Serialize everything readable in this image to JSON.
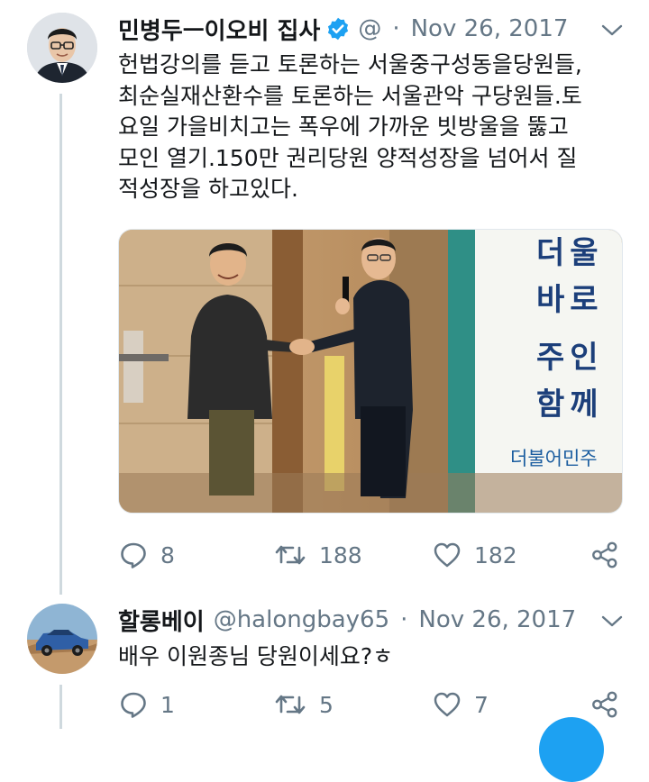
{
  "tweet": {
    "author_name": "민병두ㅡ이오비 집사",
    "handle": "@",
    "separator": "·",
    "date": "Nov 26, 2017",
    "text_lines": [
      "헌법강의를 듣고 토론하는 서울중구성동을당원들,",
      "최순실재산환수를 토론하는 서울관악 구당원들.토",
      "요일 가을비치고는 폭우에 가까운 빗방울을 뚫고",
      "모인 열기.150만 권리당원 양적성장을 넘어서 질",
      "적성장을 하고있다."
    ],
    "photo": {
      "banner_text": [
        "더",
        "울",
        "바",
        "로",
        "주",
        "인",
        "함",
        "께"
      ],
      "banner_footer": "더불어민주"
    },
    "stats": {
      "replies": "8",
      "retweets": "188",
      "likes": "182"
    }
  },
  "reply": {
    "author_name": "할롱베이",
    "handle": "@halongbay65",
    "separator": "·",
    "date": "Nov 26, 2017",
    "text": "배우 이원종님 당원이세요?ㅎ",
    "stats": {
      "replies": "1",
      "retweets": "5",
      "likes": "7"
    }
  },
  "colors": {
    "verified": "#1da1f2",
    "muted": "#657786",
    "text": "#14171a",
    "line": "#cfd9de"
  }
}
